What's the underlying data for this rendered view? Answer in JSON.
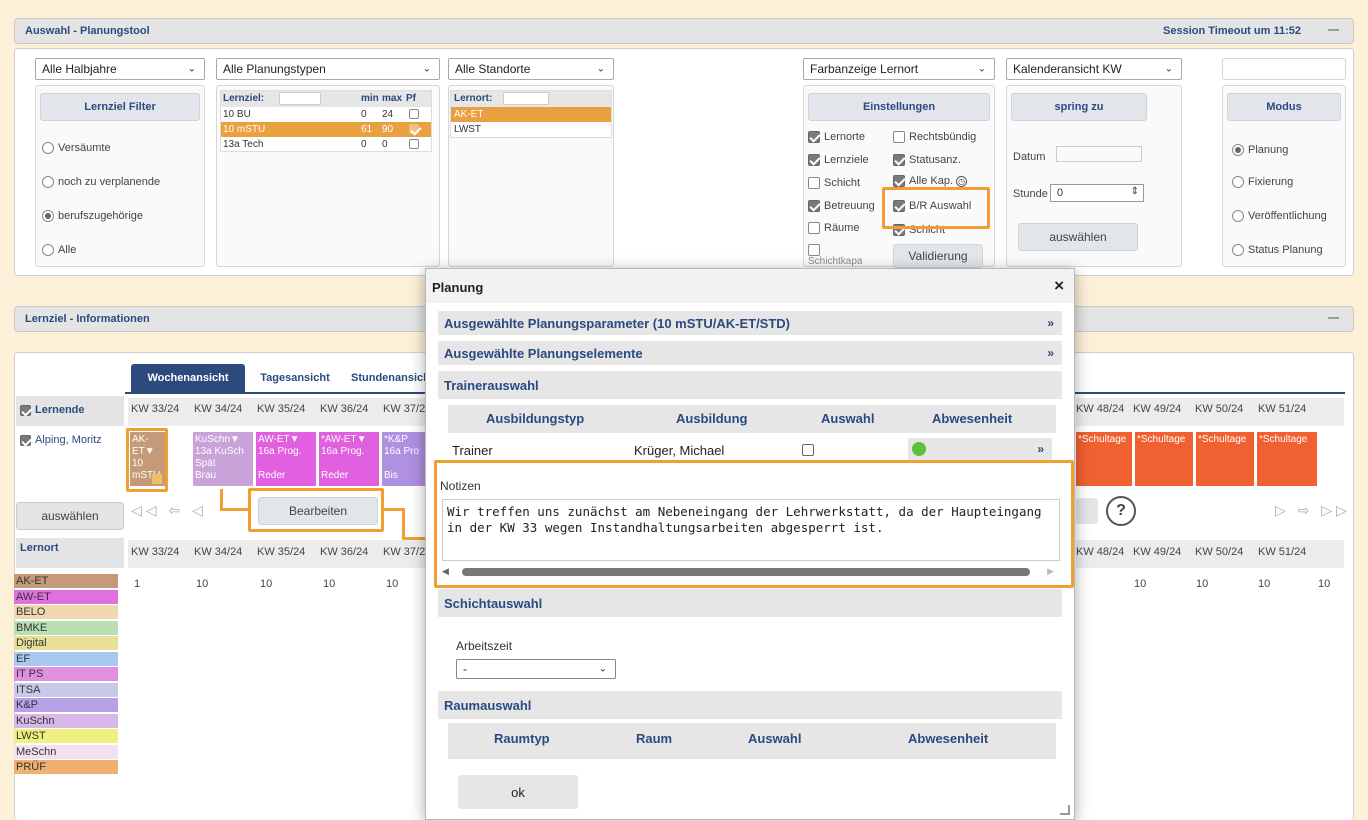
{
  "app": {
    "title": "Auswahl - Planungstool",
    "session": "Session Timeout um 11:52",
    "minimize": "—"
  },
  "filters": {
    "halbjahre": "Alle Halbjahre",
    "planungstypen": "Alle Planungstypen",
    "standorte": "Alle Standorte",
    "farbanzeige": "Farbanzeige Lernort",
    "kalender": "Kalenderansicht KW"
  },
  "lernziel_filter": {
    "button": "Lernziel Filter",
    "options": [
      "Versäumte",
      "noch zu verplanende",
      "berufszugehörige",
      "Alle"
    ],
    "selected": 2
  },
  "lernziel_table": {
    "label": "Lernziel:",
    "col_min": "min",
    "col_max": "max",
    "col_pf": "Pf",
    "rows": [
      {
        "name": "10 BU",
        "min": "0",
        "max": "24",
        "checked": false,
        "selected": false
      },
      {
        "name": "10 mSTU",
        "min": "61",
        "max": "90",
        "checked": true,
        "selected": true
      },
      {
        "name": "13a Tech",
        "min": "0",
        "max": "0",
        "checked": false,
        "selected": false
      }
    ]
  },
  "lernort_table": {
    "label": "Lernort:",
    "rows": [
      {
        "name": "AK-ET",
        "selected": true
      },
      {
        "name": "LWST",
        "selected": false
      }
    ]
  },
  "einstellungen": {
    "button": "Einstellungen",
    "checks": [
      {
        "label": "Lernorte",
        "on": true
      },
      {
        "label": "Rechtsbündig",
        "on": false
      },
      {
        "label": "Lernziele",
        "on": true
      },
      {
        "label": "Statusanz.",
        "on": true
      },
      {
        "label": "Schicht",
        "on": false
      },
      {
        "label": "Alle Kap.",
        "on": true
      },
      {
        "label": "Betreuung",
        "on": true
      },
      {
        "label": "B/R Auswahl",
        "on": true
      },
      {
        "label": "Räume",
        "on": false
      },
      {
        "label": "Schicht",
        "on": true
      },
      {
        "label": "Schichtkapa",
        "on": false
      }
    ],
    "validierung": "Validierung"
  },
  "springzu": {
    "button": "spring zu",
    "datum_label": "Datum",
    "stunde_label": "Stunde",
    "stunde_value": "0",
    "auswaehlen": "auswählen"
  },
  "modus": {
    "button": "Modus",
    "options": [
      "Planung",
      "Fixierung",
      "Veröffentlichung",
      "Status Planung"
    ],
    "selected": 0
  },
  "info": {
    "title": "Lernziel - Informationen",
    "minimize": "—"
  },
  "tabs": [
    "Wochenansicht",
    "Tagesansicht",
    "Stundenansicht"
  ],
  "left": {
    "lernende": "Lernende",
    "student": "Alping, Moritz",
    "auswaehlen": "auswählen",
    "lernort": "Lernort"
  },
  "weeks_left": [
    "KW 33/24",
    "KW 34/24",
    "KW 35/24",
    "KW 36/24",
    "KW 37/24"
  ],
  "weeks_right": [
    "KW 48/24",
    "KW 49/24",
    "KW 50/24",
    "KW 51/24"
  ],
  "cells": [
    {
      "t1": "AK-ET",
      "t2": "10 mSTU",
      "t3": "",
      "t4": "",
      "color": "#c49a78"
    },
    {
      "t1": "KuSchn",
      "t2": "13a KuSch",
      "t3": "Spät",
      "t4": "Brau",
      "color": "#c8a2d8"
    },
    {
      "t1": "AW-ET",
      "t2": "16a Prog.",
      "t3": "",
      "t4": "Reder",
      "color": "#e060e0"
    },
    {
      "t1": "*AW-ET",
      "t2": "16a Prog.",
      "t3": "",
      "t4": "Reder",
      "color": "#e060e0"
    },
    {
      "t1": "*K&P",
      "t2": "16a Pro",
      "t3": "",
      "t4": "Bis",
      "color": "#b090e0"
    }
  ],
  "cells_right": [
    "*Schultage",
    "*Schultage",
    "*Schultage",
    "*Schultage"
  ],
  "bearbeiten": "Bearbeiten",
  "help": "?",
  "values_left": [
    "1",
    "10",
    "10",
    "10",
    "10"
  ],
  "values_right": [
    "10",
    "10",
    "10",
    "10"
  ],
  "legend": [
    {
      "label": "AK-ET",
      "color": "#c49a78"
    },
    {
      "label": "AW-ET",
      "color": "#e070e0"
    },
    {
      "label": "BELO",
      "color": "#f0d8b0"
    },
    {
      "label": "BMKE",
      "color": "#b8e0b0"
    },
    {
      "label": "Digital",
      "color": "#e8e098"
    },
    {
      "label": "EF",
      "color": "#a8c8f0"
    },
    {
      "label": "IT PS",
      "color": "#e090e0"
    },
    {
      "label": "ITSA",
      "color": "#c8c8e8"
    },
    {
      "label": "K&P",
      "color": "#b8a0e8"
    },
    {
      "label": "KuSchn",
      "color": "#d8b8e8"
    },
    {
      "label": "LWST",
      "color": "#f0f080"
    },
    {
      "label": "MeSchn",
      "color": "#f0e0f0"
    },
    {
      "label": "PRÜF",
      "color": "#f0b070"
    }
  ],
  "modal": {
    "title": "Planung",
    "close": "×",
    "sec1": "Ausgewählte Planungsparameter (10 mSTU/AK-ET/STD)",
    "sec2": "Ausgewählte Planungselemente",
    "trainer_title": "Trainerauswahl",
    "trainer_cols": [
      "Ausbildungstyp",
      "Ausbildung",
      "Auswahl",
      "Abwesenheit"
    ],
    "trainer_row": {
      "typ": "Trainer",
      "name": "Krüger, Michael"
    },
    "notizen_label": "Notizen",
    "notizen_text": "Wir treffen uns zunächst am Nebeneingang der Lehrwerkstatt, da der Haupteingang in der KW 33 wegen Instandhaltungsarbeiten abgesperrt ist.",
    "schicht_title": "Schichtauswahl",
    "arbeitszeit_label": "Arbeitszeit",
    "arbeitszeit_value": "-",
    "raum_title": "Raumauswahl",
    "raum_cols": [
      "Raumtyp",
      "Raum",
      "Auswahl",
      "Abwesenheit"
    ],
    "ok": "ok"
  },
  "colors": {
    "accent": "#f0a030",
    "header_text": "#2a4a80",
    "selected_row": "#e8a040",
    "schultage": "#f06030"
  }
}
